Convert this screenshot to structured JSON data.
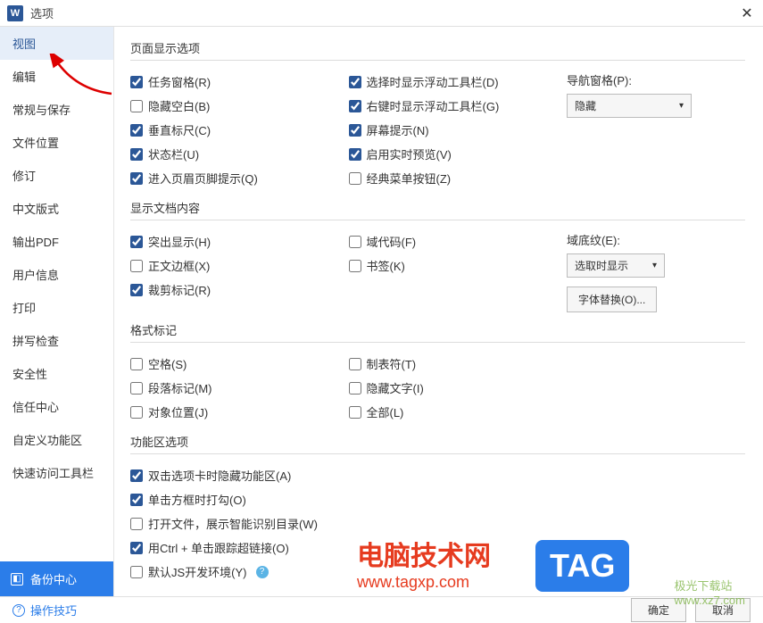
{
  "titlebar": {
    "title": "选项",
    "app_letter": "W"
  },
  "sidebar": {
    "items": [
      "视图",
      "编辑",
      "常规与保存",
      "文件位置",
      "修订",
      "中文版式",
      "输出PDF",
      "用户信息",
      "打印",
      "拼写检查",
      "安全性",
      "信任中心",
      "自定义功能区",
      "快速访问工具栏"
    ],
    "backup": "备份中心"
  },
  "sections": {
    "page_display": {
      "title": "页面显示选项",
      "col1": [
        {
          "label": "任务窗格(R)",
          "checked": true
        },
        {
          "label": "隐藏空白(B)",
          "checked": false
        },
        {
          "label": "垂直标尺(C)",
          "checked": true
        },
        {
          "label": "状态栏(U)",
          "checked": true
        },
        {
          "label": "进入页眉页脚提示(Q)",
          "checked": true
        }
      ],
      "col2": [
        {
          "label": "选择时显示浮动工具栏(D)",
          "checked": true
        },
        {
          "label": "右键时显示浮动工具栏(G)",
          "checked": true
        },
        {
          "label": "屏幕提示(N)",
          "checked": true
        },
        {
          "label": "启用实时预览(V)",
          "checked": true
        },
        {
          "label": "经典菜单按钮(Z)",
          "checked": false
        }
      ],
      "nav_label": "导航窗格(P):",
      "nav_value": "隐藏"
    },
    "doc_content": {
      "title": "显示文档内容",
      "col1": [
        {
          "label": "突出显示(H)",
          "checked": true
        },
        {
          "label": "正文边框(X)",
          "checked": false
        },
        {
          "label": "裁剪标记(R)",
          "checked": true
        }
      ],
      "col2": [
        {
          "label": "域代码(F)",
          "checked": false
        },
        {
          "label": "书签(K)",
          "checked": false
        }
      ],
      "shade_label": "域底纹(E):",
      "shade_value": "选取时显示",
      "font_sub": "字体替换(O)..."
    },
    "format_marks": {
      "title": "格式标记",
      "col1": [
        {
          "label": "空格(S)",
          "checked": false
        },
        {
          "label": "段落标记(M)",
          "checked": false
        },
        {
          "label": "对象位置(J)",
          "checked": false
        }
      ],
      "col2": [
        {
          "label": "制表符(T)",
          "checked": false
        },
        {
          "label": "隐藏文字(I)",
          "checked": false
        },
        {
          "label": "全部(L)",
          "checked": false
        }
      ]
    },
    "ribbon": {
      "title": "功能区选项",
      "items": [
        {
          "label": "双击选项卡时隐藏功能区(A)",
          "checked": true
        },
        {
          "label": "单击方框时打勾(O)",
          "checked": true
        },
        {
          "label": "打开文件，展示智能识别目录(W)",
          "checked": false
        },
        {
          "label": "用Ctrl + 单击跟踪超链接(O)",
          "checked": true
        },
        {
          "label": "默认JS开发环境(Y)",
          "checked": false,
          "info": true
        }
      ]
    }
  },
  "footer": {
    "tips": "操作技巧",
    "ok": "确定",
    "cancel": "取消"
  },
  "watermarks": {
    "w1a": "电脑技术网",
    "w1b": "www.tagxp.com",
    "w2": "TAG",
    "w3a": "极光下载站",
    "w3b": "www.xz7.com"
  }
}
